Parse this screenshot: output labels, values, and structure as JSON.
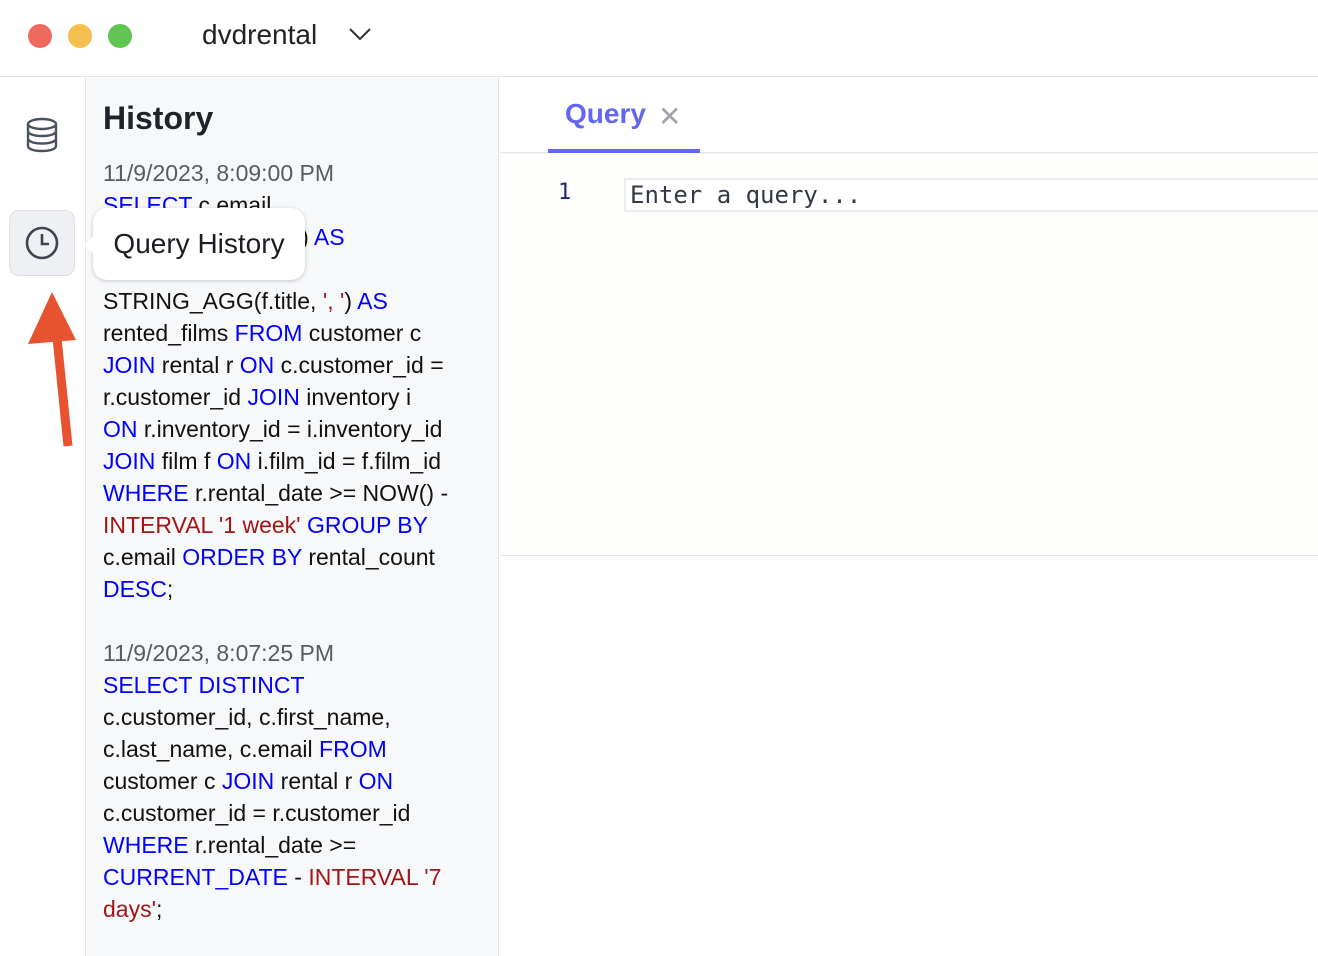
{
  "window": {
    "db_name": "dvdrental"
  },
  "rail": {
    "items": [
      {
        "icon": "database-icon"
      },
      {
        "icon": "clock-icon",
        "tooltip": "Query History"
      }
    ]
  },
  "history": {
    "title": "History",
    "entries": [
      {
        "timestamp": "11/9/2023, 8:09:00 PM",
        "lines": [
          [
            [
              "kw",
              "SELECT"
            ],
            [
              "p",
              " c.email"
            ]
          ],
          [
            [
              "p",
              "l) "
            ],
            [
              "kw",
              "AS"
            ]
          ],
          [],
          [
            [
              "p",
              "STRING_AGG(f.title, "
            ],
            [
              "str",
              "', '"
            ],
            [
              "p",
              ") "
            ],
            [
              "kw",
              "AS"
            ]
          ],
          [
            [
              "p",
              "rented_films "
            ],
            [
              "kw",
              "FROM"
            ],
            [
              "p",
              " customer c"
            ]
          ],
          [
            [
              "kw",
              "JOIN"
            ],
            [
              "p",
              " rental r "
            ],
            [
              "kw",
              "ON"
            ],
            [
              "p",
              " c.customer_id ="
            ]
          ],
          [
            [
              "p",
              "r.customer_id "
            ],
            [
              "kw",
              "JOIN"
            ],
            [
              "p",
              " inventory i"
            ]
          ],
          [
            [
              "kw",
              "ON"
            ],
            [
              "p",
              " r.inventory_id = i.inventory_id"
            ]
          ],
          [
            [
              "kw",
              "JOIN"
            ],
            [
              "p",
              " film f "
            ],
            [
              "kw",
              "ON"
            ],
            [
              "p",
              " i.film_id = f.film_id"
            ]
          ],
          [
            [
              "kw",
              "WHERE"
            ],
            [
              "p",
              " r.rental_date >= NOW() -"
            ]
          ],
          [
            [
              "str",
              "INTERVAL '1 week'"
            ],
            [
              "p",
              " "
            ],
            [
              "kw",
              "GROUP BY"
            ]
          ],
          [
            [
              "p",
              "c.email "
            ],
            [
              "kw",
              "ORDER BY"
            ],
            [
              "p",
              " rental_count"
            ]
          ],
          [
            [
              "kw",
              "DESC"
            ],
            [
              "p",
              ";"
            ]
          ]
        ]
      },
      {
        "timestamp": "11/9/2023, 8:07:25 PM",
        "lines": [
          [
            [
              "kw",
              "SELECT DISTINCT"
            ]
          ],
          [
            [
              "p",
              "c.customer_id, c.first_name,"
            ]
          ],
          [
            [
              "p",
              "c.last_name, c.email "
            ],
            [
              "kw",
              "FROM"
            ]
          ],
          [
            [
              "p",
              "customer c "
            ],
            [
              "kw",
              "JOIN"
            ],
            [
              "p",
              " rental r "
            ],
            [
              "kw",
              "ON"
            ]
          ],
          [
            [
              "p",
              "c.customer_id = r.customer_id"
            ]
          ],
          [
            [
              "kw",
              "WHERE"
            ],
            [
              "p",
              " r.rental_date >="
            ]
          ],
          [
            [
              "kw",
              "CURRENT_DATE"
            ],
            [
              "p",
              " - "
            ],
            [
              "str",
              "INTERVAL '7"
            ]
          ],
          [
            [
              "str",
              "days'"
            ],
            [
              "p",
              ";"
            ]
          ]
        ]
      }
    ]
  },
  "tabs": [
    {
      "label": "Query",
      "active": true
    }
  ],
  "editor": {
    "line_number": "1",
    "placeholder": "Enter a query..."
  },
  "colors": {
    "accent": "#6366f1",
    "keyword": "#0000ff",
    "string": "#a31515",
    "annotation_arrow": "#e8532f"
  }
}
